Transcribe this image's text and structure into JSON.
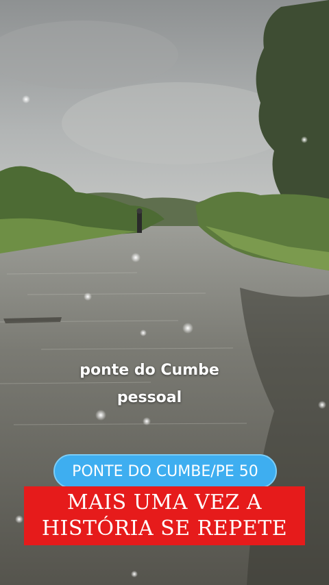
{
  "caption": {
    "line1": "ponte do Cumbe",
    "line2": "pessoal"
  },
  "title_pill": {
    "text": "PONTE DO CUMBE/PE 50"
  },
  "banner": {
    "line1": "MAIS UMA VEZ A",
    "line2": "HISTÓRIA SE REPETE"
  },
  "colors": {
    "pill": "#3eaef0",
    "banner": "#e61b1b",
    "text": "#ffffff"
  }
}
